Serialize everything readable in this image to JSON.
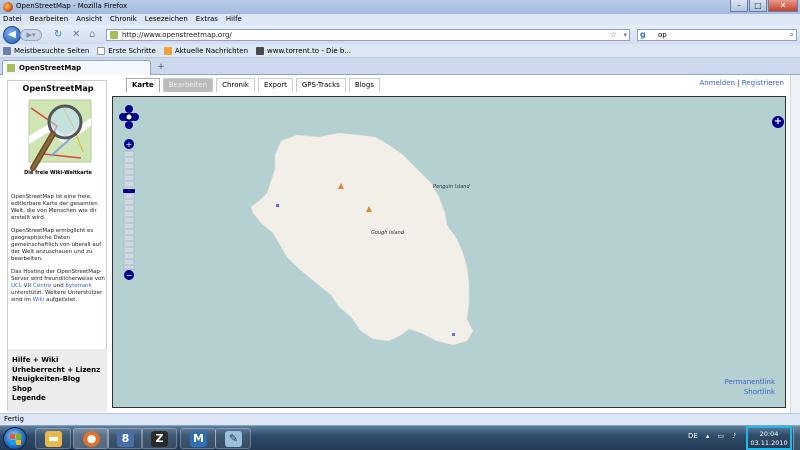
{
  "window": {
    "title": "OpenStreetMap - Mozilla Firefox",
    "buttons": {
      "minimize": "–",
      "maximize": "□",
      "close": "✕"
    }
  },
  "menu": [
    "Datei",
    "Bearbeiten",
    "Ansicht",
    "Chronik",
    "Lesezeichen",
    "Extras",
    "Hilfe"
  ],
  "nav": {
    "url": "http://www.openstreetmap.org/",
    "search_value": "op",
    "search_engine_label": "g"
  },
  "bookmarks": [
    {
      "label": "Meistbesuchte Seiten",
      "color": "#6b7fa8"
    },
    {
      "label": "Erste Schritte",
      "color": "#e2e2e2"
    },
    {
      "label": "Aktuelle Nachrichten",
      "color": "#f2a23a"
    },
    {
      "label": "www.torrent.to - Die b...",
      "color": "#4a4a4a"
    }
  ],
  "tab": {
    "label": "OpenStreetMap",
    "new_tab": "+"
  },
  "sidebar": {
    "title": "OpenStreetMap",
    "caption": "Die freie Wiki-Weltkarte",
    "para1": "OpenStreetMap ist eine freie, editierbare Karte der gesamten Welt, die von Menschen wie dir erstellt wird.",
    "para2": "OpenStreetMap ermöglicht es geographische Daten gemeinschaftlich von überall auf der Welt anzuschauen und zu bearbeiten.",
    "para3_a": "Das Hosting der OpenStreetMap-Server wird freundlicherweise von ",
    "para3_link1": "UCL VR Centre",
    "para3_b": " und ",
    "para3_link2": "bytemark",
    "para3_c": " unterstützt. Weitere Unterstützer sind im ",
    "para3_link3": "Wiki",
    "para3_d": " aufgelistet.",
    "links": [
      "Hilfe + Wiki",
      "Urheberrecht + Lizenz",
      "Neuigkeiten-Blog",
      "Shop",
      "Legende"
    ]
  },
  "page_tabs": [
    "Karte",
    "Bearbeiten",
    "Chronik",
    "Export",
    "GPS-Tracks",
    "Blogs"
  ],
  "user_links": {
    "login": "Anmelden",
    "separator": "|",
    "register": "Registrieren"
  },
  "map": {
    "island_label": "Gough Island",
    "place_label": "Penguin Island",
    "permalink": "Permanentlink",
    "shortlink": "Shortlink",
    "water_color": "#b5d0d0",
    "land_color": "#f2efe9",
    "zoom_in": "+",
    "zoom_out": "−",
    "layer_switcher": "+"
  },
  "status": {
    "text": "Fertig"
  },
  "taskbar": {
    "apps": [
      {
        "name": "explorer",
        "glyph": "▬",
        "color": "#e8b84a"
      },
      {
        "name": "firefox",
        "glyph": "●",
        "color": "#e0702a"
      },
      {
        "name": "app-8",
        "glyph": "8",
        "color": "#4a6fa8"
      },
      {
        "name": "app-z",
        "glyph": "Z",
        "color": "#2a2a2a"
      },
      {
        "name": "app-m",
        "glyph": "M",
        "color": "#2f6fb8"
      },
      {
        "name": "paint",
        "glyph": "✎",
        "color": "#9ac0e0"
      }
    ],
    "language": "DE",
    "clock_time": "20:04",
    "clock_date": "03.11.2010"
  }
}
